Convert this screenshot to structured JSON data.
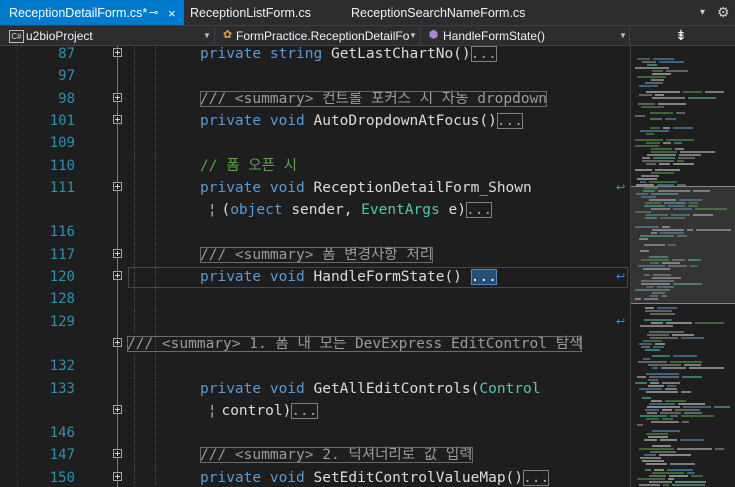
{
  "tabs": [
    {
      "label": "ReceptionDetailForm.cs*",
      "active": true,
      "pin_glyph": "⊸",
      "close_glyph": "×"
    },
    {
      "label": "ReceptionListForm.cs",
      "active": false
    },
    {
      "label": "ReceptionSearchNameForm.cs",
      "active": false
    }
  ],
  "tab_overflow_glyph": "▾",
  "settings_glyph": "⚙",
  "nav": {
    "project": {
      "icon": "C#",
      "label": "u2bioProject"
    },
    "class": {
      "label": "FormPractice.ReceptionDetailFo"
    },
    "member": {
      "label": "HandleFormState()"
    },
    "split_glyph": "⇟"
  },
  "code_lines": [
    {
      "num": "87",
      "fold": true,
      "tokens": [
        {
          "t": "private",
          "c": "kw"
        },
        {
          "t": " "
        },
        {
          "t": "string",
          "c": "kw"
        },
        {
          "t": " GetLastChartNo()"
        },
        {
          "t": "...",
          "c": "coll"
        }
      ]
    },
    {
      "num": "97",
      "fold": false,
      "tokens": []
    },
    {
      "num": "98",
      "fold": true,
      "tokens": [
        {
          "t": "/// <summary> 컨트롤 포커스 시 자동 dropdown",
          "c": "cm-box"
        }
      ]
    },
    {
      "num": "101",
      "fold": true,
      "tokens": [
        {
          "t": "private",
          "c": "kw"
        },
        {
          "t": " "
        },
        {
          "t": "void",
          "c": "kw"
        },
        {
          "t": " AutoDropdownAtFocus()"
        },
        {
          "t": "...",
          "c": "coll"
        }
      ]
    },
    {
      "num": "109",
      "fold": false,
      "tokens": []
    },
    {
      "num": "110",
      "fold": false,
      "tokens": [
        {
          "t": "// 폼 오픈 시",
          "c": "cm"
        }
      ]
    },
    {
      "num": "111",
      "fold": true,
      "refs": true,
      "tokens": [
        {
          "t": "private",
          "c": "kw"
        },
        {
          "t": " "
        },
        {
          "t": "void",
          "c": "kw"
        },
        {
          "t": " ReceptionDetailForm_Shown"
        }
      ]
    },
    {
      "num": "",
      "fold": false,
      "cont": true,
      "tokens": [
        {
          "t": "  ("
        },
        {
          "t": "object",
          "c": "kw"
        },
        {
          "t": " sender, "
        },
        {
          "t": "EventArgs",
          "c": "ty"
        },
        {
          "t": " e)"
        },
        {
          "t": "...",
          "c": "coll"
        }
      ]
    },
    {
      "num": "116",
      "fold": false,
      "tokens": []
    },
    {
      "num": "117",
      "fold": true,
      "tokens": [
        {
          "t": "/// <summary> 폼 변경사항 처리",
          "c": "cm-box"
        }
      ]
    },
    {
      "num": "120",
      "fold": true,
      "refs": true,
      "current": true,
      "tokens": [
        {
          "t": "private",
          "c": "kw"
        },
        {
          "t": " "
        },
        {
          "t": "void",
          "c": "kw"
        },
        {
          "t": " HandleFormState() "
        },
        {
          "t": "...",
          "c": "coll sel"
        }
      ]
    },
    {
      "num": "128",
      "fold": false,
      "tokens": []
    },
    {
      "num": "129",
      "fold": false,
      "refs": true,
      "tokens": []
    },
    {
      "num": "",
      "fold": true,
      "outdent": true,
      "tokens": [
        {
          "t": "/// <summary> 1. 폼 내 모든 DevExpress EditControl 탐색",
          "c": "cm-box"
        }
      ]
    },
    {
      "num": "132",
      "fold": false,
      "tokens": []
    },
    {
      "num": "133",
      "fold": false,
      "tokens": [
        {
          "t": "private",
          "c": "kw"
        },
        {
          "t": " "
        },
        {
          "t": "void",
          "c": "kw"
        },
        {
          "t": " GetAllEditControls("
        },
        {
          "t": "Control",
          "c": "ty"
        }
      ]
    },
    {
      "num": "",
      "fold": true,
      "cont": true,
      "tokens": [
        {
          "t": "  control)"
        },
        {
          "t": "...",
          "c": "coll"
        }
      ]
    },
    {
      "num": "146",
      "fold": false,
      "tokens": []
    },
    {
      "num": "147",
      "fold": true,
      "tokens": [
        {
          "t": "/// <summary> 2. 딕셔너리로 값 입력",
          "c": "cm-box"
        }
      ]
    },
    {
      "num": "150",
      "fold": true,
      "tokens": [
        {
          "t": "private",
          "c": "kw"
        },
        {
          "t": " "
        },
        {
          "t": "void",
          "c": "kw"
        },
        {
          "t": " SetEditControlValueMap()"
        },
        {
          "t": "...",
          "c": "coll"
        }
      ]
    }
  ],
  "refs_glyph": "↩",
  "colors": {
    "active_tab": "#007acc",
    "keyword": "#569cd6",
    "type": "#4ec9b0",
    "comment": "#57a64a",
    "line_number": "#2b91af",
    "editor_bg": "#1e1e1e"
  }
}
